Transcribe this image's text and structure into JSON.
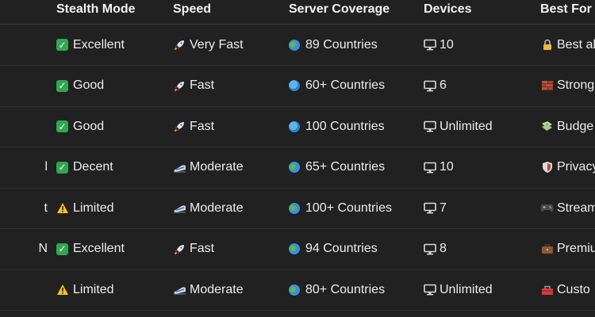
{
  "table": {
    "headers": [
      "Stealth Mode",
      "Speed",
      "Server Coverage",
      "Devices",
      "Best For"
    ],
    "rows": [
      {
        "name_fragment": "",
        "stealth": "Excellent",
        "stealth_icon": "check-icon",
        "speed": "Very Fast",
        "speed_icon": "rocket-icon",
        "coverage": "89 Countries",
        "coverage_icon": "globe-icon",
        "devices": "10",
        "devices_icon": "monitor-icon",
        "best_for": "Best al",
        "best_icon": "lock-icon"
      },
      {
        "name_fragment": "",
        "stealth": "Good",
        "stealth_icon": "check-icon",
        "speed": "Fast",
        "speed_icon": "rocket-icon",
        "coverage": "60+ Countries",
        "coverage_icon": "globe-meridians-icon",
        "devices": "6",
        "devices_icon": "monitor-icon",
        "best_for": "Strong",
        "best_icon": "bricks-icon"
      },
      {
        "name_fragment": "",
        "stealth": "Good",
        "stealth_icon": "check-icon",
        "speed": "Fast",
        "speed_icon": "rocket-icon",
        "coverage": "100 Countries",
        "coverage_icon": "globe-meridians-icon",
        "devices": "Unlimited",
        "devices_icon": "monitor-icon",
        "best_for": "Budge",
        "best_icon": "money-icon"
      },
      {
        "name_fragment": "l",
        "stealth": "Decent",
        "stealth_icon": "check-icon",
        "speed": "Moderate",
        "speed_icon": "train-icon",
        "coverage": "65+ Countries",
        "coverage_icon": "globe-icon",
        "devices": "10",
        "devices_icon": "monitor-icon",
        "best_for": "Privacy",
        "best_icon": "shield-icon"
      },
      {
        "name_fragment": "t",
        "stealth": "Limited",
        "stealth_icon": "warning-icon",
        "speed": "Moderate",
        "speed_icon": "train-icon",
        "coverage": "100+ Countries",
        "coverage_icon": "globe-icon",
        "devices": "7",
        "devices_icon": "monitor-icon",
        "best_for": "Stream",
        "best_icon": "gamepad-icon"
      },
      {
        "name_fragment": "N",
        "stealth": "Excellent",
        "stealth_icon": "check-icon",
        "speed": "Fast",
        "speed_icon": "rocket-icon",
        "coverage": "94 Countries",
        "coverage_icon": "globe-icon",
        "devices": "8",
        "devices_icon": "monitor-icon",
        "best_for": "Premiu",
        "best_icon": "briefcase-icon"
      },
      {
        "name_fragment": "",
        "stealth": "Limited",
        "stealth_icon": "warning-icon",
        "speed": "Moderate",
        "speed_icon": "train-icon",
        "coverage": "80+ Countries",
        "coverage_icon": "globe-icon",
        "devices": "Unlimited",
        "devices_icon": "monitor-icon",
        "best_for": "Custo",
        "best_icon": "toolbox-icon"
      }
    ]
  },
  "colors": {
    "background": "#212121",
    "text": "#ececec",
    "divider": "#303030",
    "check": "#2fa84f"
  }
}
